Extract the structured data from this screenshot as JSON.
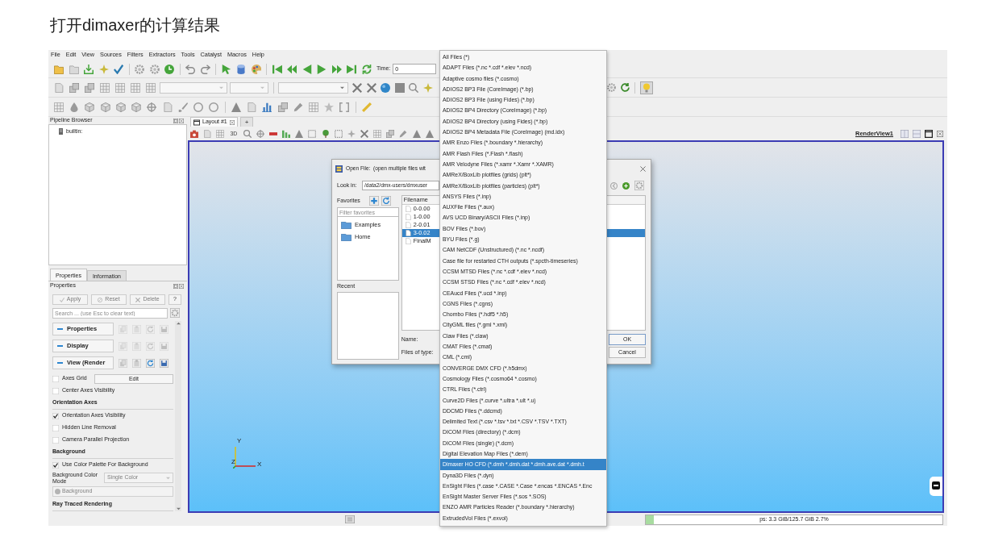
{
  "page_title": "打开dimaxer的计算结果",
  "menu_bar": [
    "File",
    "Edit",
    "View",
    "Sources",
    "Filters",
    "Extractors",
    "Tools",
    "Catalyst",
    "Macros",
    "Help"
  ],
  "time": {
    "label": "Time:",
    "value": "0"
  },
  "pipeline_browser": {
    "title": "Pipeline Browser",
    "items": [
      "builtin:"
    ]
  },
  "panel_tabs": [
    {
      "label": "Properties",
      "selected": true
    },
    {
      "label": "Information",
      "selected": false
    }
  ],
  "properties": {
    "title": "Properties",
    "buttons": [
      {
        "kind": "apply",
        "label": "Apply",
        "disabled": true
      },
      {
        "kind": "reset",
        "label": "Reset",
        "disabled": true
      },
      {
        "kind": "delete",
        "label": "Delete",
        "disabled": true
      },
      {
        "kind": "help",
        "label": "?",
        "disabled": false
      }
    ],
    "search": {
      "placeholder": "Search ... (use Esc to clear text)"
    },
    "sections": [
      {
        "label": "Properties",
        "expanded": true,
        "tools_disabled": true
      },
      {
        "label": "Display",
        "expanded": true,
        "tools_disabled": true
      },
      {
        "label": "View (Render",
        "expanded": true,
        "tools_disabled": false
      }
    ],
    "rows": [
      {
        "kind": "checkbox_button",
        "label": "Axes Grid",
        "checked": false,
        "button": "Edit"
      },
      {
        "kind": "checkbox",
        "label": "Center Axes Visibility",
        "checked": false
      },
      {
        "kind": "heading",
        "label": "Orientation Axes"
      },
      {
        "kind": "checkbox",
        "label": "Orientation Axes Visibility",
        "checked": true
      },
      {
        "kind": "checkbox",
        "label": "Hidden Line Removal",
        "checked": false
      },
      {
        "kind": "checkbox",
        "label": "Camera Parallel Projection",
        "checked": false
      },
      {
        "kind": "heading",
        "label": "Background"
      },
      {
        "kind": "checkbox",
        "label": "Use Color Palette For Background",
        "checked": true
      },
      {
        "kind": "select",
        "label": "Background Color Mode",
        "value": "Single Color",
        "disabled": true
      },
      {
        "kind": "color_button",
        "label": "Background",
        "disabled": true
      },
      {
        "kind": "heading",
        "label": "Ray Traced Rendering"
      }
    ]
  },
  "layout_tabs": [
    {
      "kind": "layout",
      "label": "Layout #1",
      "selected": true
    },
    {
      "kind": "add",
      "label": "+",
      "selected": false
    }
  ],
  "render_toolbar": {
    "mode_label": "3D",
    "view_name": "RenderView1"
  },
  "view": {
    "axes_labels": [
      "Y",
      "Z",
      "X"
    ]
  },
  "status_bar": {
    "memory": "ps: 3.3 GiB/125.7 GiB 2.7%",
    "level": 0.027
  },
  "dialog": {
    "title": "Open File:  (open multiple files wit",
    "look_in": {
      "label": "Look in:",
      "value": "/data2/dmx-users/dmxuser"
    },
    "favorites": {
      "label": "Favorites",
      "filter_placeholder": "Filter favorites",
      "items": [
        "Examples",
        "Home"
      ]
    },
    "recent_label": "Recent",
    "file_column": "Filename",
    "files": [
      {
        "name": "0-0.00",
        "selected": false
      },
      {
        "name": "1-0.00",
        "selected": false
      },
      {
        "name": "2-0.01",
        "selected": false
      },
      {
        "name": "3-0.02",
        "selected": true
      },
      {
        "name": "FinalM",
        "selected": false
      }
    ],
    "name_label": "Name:",
    "type_label": "Files of type:",
    "buttons": [
      {
        "kind": "default",
        "label": "OK"
      },
      {
        "kind": "normal",
        "label": "Cancel"
      }
    ]
  },
  "file_types": [
    {
      "label": "All Files (*)",
      "selected": false
    },
    {
      "label": "ADAPT Files (*.nc *.cdf *.elev *.ncd)",
      "selected": false
    },
    {
      "label": "Adaptive cosmo files (*.cosmo)",
      "selected": false
    },
    {
      "label": "ADIOS2 BP3 File (CoreImage) (*.bp)",
      "selected": false
    },
    {
      "label": "ADIOS2 BP3 File (using Fides) (*.bp)",
      "selected": false
    },
    {
      "label": "ADIOS2 BP4 Directory (CoreImage) (*.bp)",
      "selected": false
    },
    {
      "label": "ADIOS2 BP4 Directory (using Fides) (*.bp)",
      "selected": false
    },
    {
      "label": "ADIOS2 BP4 Metadata File (CoreImage) (md.idx)",
      "selected": false
    },
    {
      "label": "AMR Enzo Files (*.boundary *.hierarchy)",
      "selected": false
    },
    {
      "label": "AMR Flash Files (*.Flash *.flash)",
      "selected": false
    },
    {
      "label": "AMR Velodyne Files (*.xamr *.Xamr *.XAMR)",
      "selected": false
    },
    {
      "label": "AMReX/BoxLib plotfiles (grids) (plt*)",
      "selected": false
    },
    {
      "label": "AMReX/BoxLib plotfiles (particles) (plt*)",
      "selected": false
    },
    {
      "label": "ANSYS Files (*.inp)",
      "selected": false
    },
    {
      "label": "AUXFile Files (*.aux)",
      "selected": false
    },
    {
      "label": "AVS UCD Binary/ASCII Files (*.inp)",
      "selected": false
    },
    {
      "label": "BOV Files (*.bov)",
      "selected": false
    },
    {
      "label": "BYU Files (*.g)",
      "selected": false
    },
    {
      "label": "CAM NetCDF (Unstructured) (*.nc *.ncdf)",
      "selected": false
    },
    {
      "label": "Case file for restarted CTH outputs (*.spcth-timeseries)",
      "selected": false
    },
    {
      "label": "CCSM MTSD Files (*.nc *.cdf *.elev *.ncd)",
      "selected": false
    },
    {
      "label": "CCSM STSD Files (*.nc *.cdf *.elev *.ncd)",
      "selected": false
    },
    {
      "label": "CEAucd Files (*.ucd *.inp)",
      "selected": false
    },
    {
      "label": "CGNS Files (*.cgns)",
      "selected": false
    },
    {
      "label": "Chombo Files (*.hdf5 *.h5)",
      "selected": false
    },
    {
      "label": "CityGML files (*.gml *.xml)",
      "selected": false
    },
    {
      "label": "Claw Files (*.claw)",
      "selected": false
    },
    {
      "label": "CMAT Files (*.cmat)",
      "selected": false
    },
    {
      "label": "CML (*.cml)",
      "selected": false
    },
    {
      "label": "CONVERGE DMX CFD (*.h5dmx)",
      "selected": false
    },
    {
      "label": "Cosmology Files (*.cosmo64 *.cosmo)",
      "selected": false
    },
    {
      "label": "CTRL Files (*.ctrl)",
      "selected": false
    },
    {
      "label": "Curve2D Files (*.curve *.ultra *.ult *.u)",
      "selected": false
    },
    {
      "label": "DDCMD Files (*.ddcmd)",
      "selected": false
    },
    {
      "label": "Delimited Text (*.csv *.tsv *.txt *.CSV *.TSV *.TXT)",
      "selected": false
    },
    {
      "label": "DICOM Files (directory) (*.dcm)",
      "selected": false
    },
    {
      "label": "DICOM Files (single) (*.dcm)",
      "selected": false
    },
    {
      "label": "Digital Elevation Map Files (*.dem)",
      "selected": false
    },
    {
      "label": "Dimaxer HO CFD (*.dmh *.dmh.dat *.dmh.ave.dat *.dmh.t",
      "selected": true
    },
    {
      "label": "Dyna3D Files (*.dyn)",
      "selected": false
    },
    {
      "label": "EnSight Files (*.case *.CASE *.Case *.encas *.ENCAS *.Enc",
      "selected": false
    },
    {
      "label": "EnSight Master Server Files (*.sos *.SOS)",
      "selected": false
    },
    {
      "label": "ENZO AMR Particles Reader (*.boundary *.hierarchy)",
      "selected": false
    },
    {
      "label": "ExtrudedVol Files (*.exvol)",
      "selected": false
    }
  ]
}
